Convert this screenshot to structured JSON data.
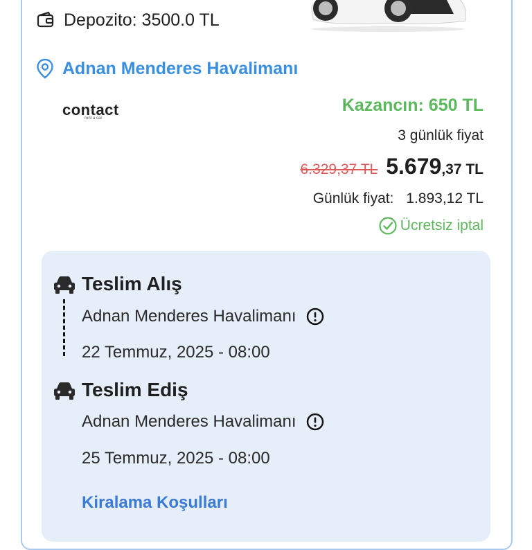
{
  "deposit": {
    "label": "Depozito: 3500.0 TL",
    "icon": "wallet-icon"
  },
  "location": {
    "label": "Adnan Menderes Havalimanı",
    "icon": "location-pin-icon"
  },
  "vendor": {
    "logo_text": "contact",
    "logo_subtext": "rent a car"
  },
  "pricing": {
    "savings": "Kazancın: 650 TL",
    "period_label": "3 günlük fiyat",
    "old_price": "6.329,37 TL",
    "new_price_main": "5.679",
    "new_price_rest": ",37 TL",
    "daily_label": "Günlük fiyat:",
    "daily_value": "1.893,12 TL",
    "free_cancel": "Ücretsiz iptal"
  },
  "pickup": {
    "title": "Teslim Alış",
    "location": "Adnan Menderes Havalimanı",
    "datetime": "22 Temmuz, 2025 - 08:00"
  },
  "dropoff": {
    "title": "Teslim Ediş",
    "location": "Adnan Menderes Havalimanı",
    "datetime": "25 Temmuz, 2025 - 08:00"
  },
  "terms_link": "Kiralama Koşulları",
  "colors": {
    "accent_blue": "#3a8fe0",
    "success_green": "#5cb85c",
    "strike_red": "#e05a5a",
    "panel_bg": "#e6eef9"
  }
}
